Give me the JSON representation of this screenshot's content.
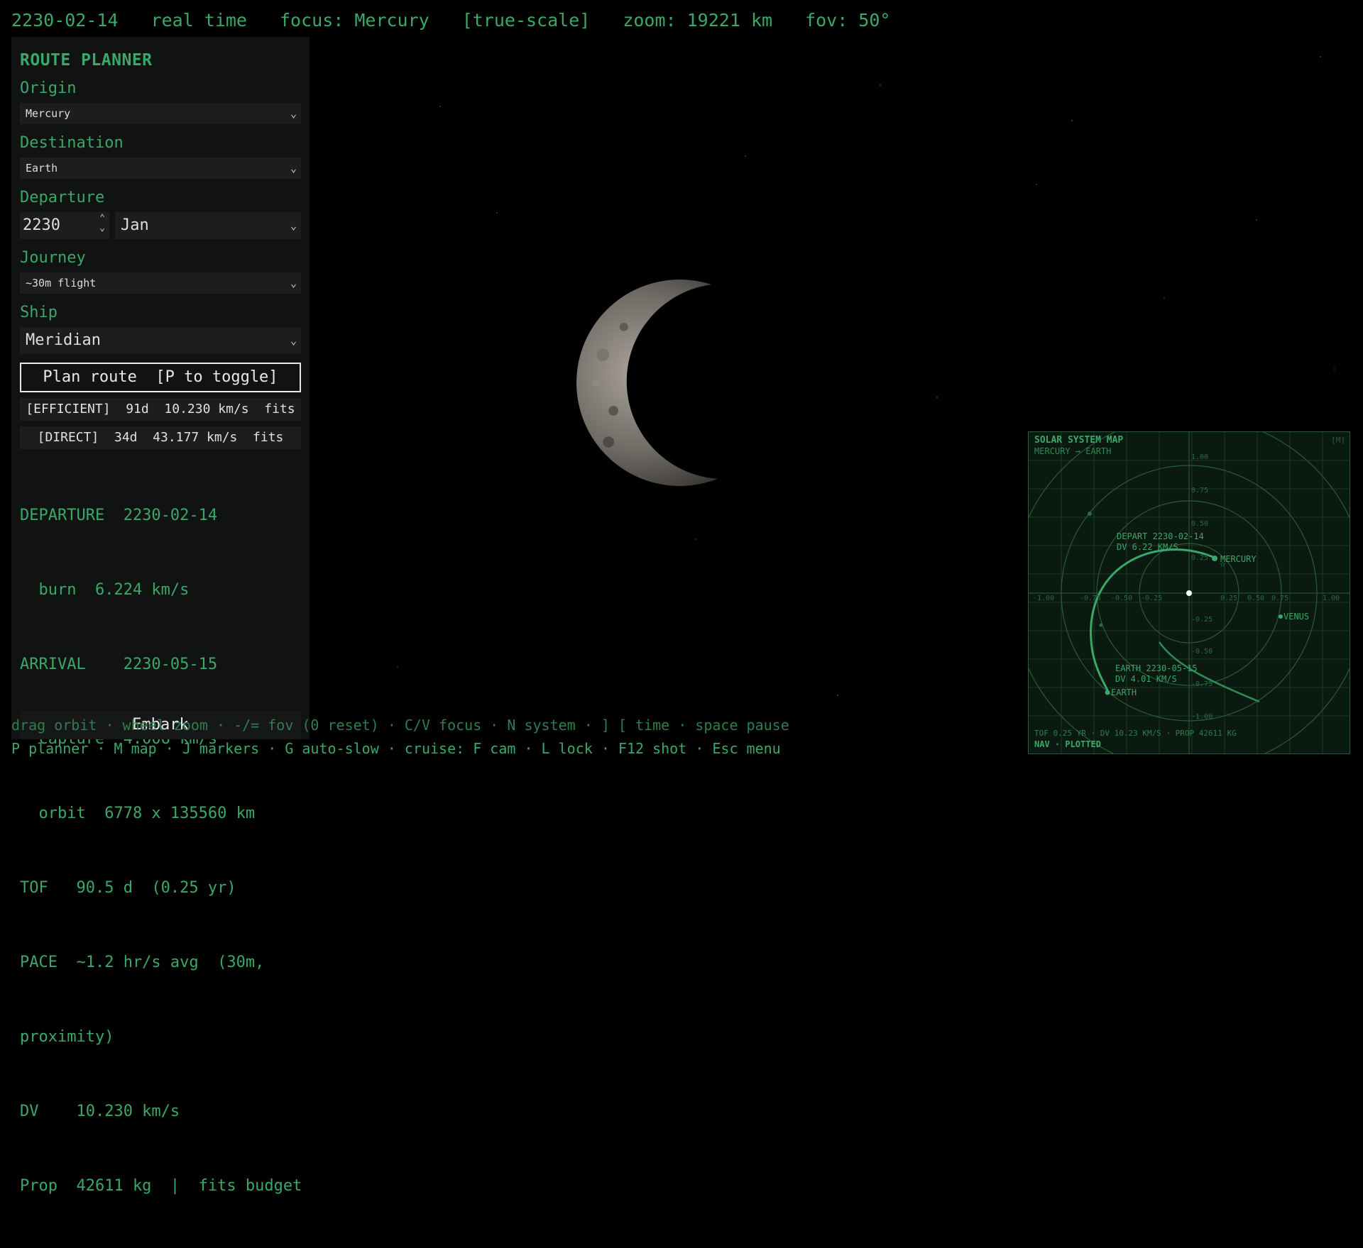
{
  "hud": {
    "date": "2230-02-14",
    "time_mode": "real time",
    "focus": "focus: Mercury",
    "scale_mode": "[true-scale]",
    "zoom": "zoom: 19221 km",
    "fov": "fov: 50°"
  },
  "planner": {
    "title": "ROUTE PLANNER",
    "origin_label": "Origin",
    "origin_value": "Mercury",
    "destination_label": "Destination",
    "destination_value": "Earth",
    "departure_label": "Departure",
    "departure_year": "2230",
    "departure_month": "Jan",
    "journey_label": "Journey",
    "journey_value": "~30m flight",
    "ship_label": "Ship",
    "ship_value": "Meridian",
    "plan_button": "Plan route  [P to toggle]",
    "options": [
      "[EFFICIENT]  91d  10.230 km/s  fits",
      "[DIRECT]  34d  43.177 km/s  fits"
    ],
    "details": [
      "DEPARTURE  2230-02-14",
      "  burn  6.224 km/s",
      "ARRIVAL    2230-05-15",
      "  capture  4.006 km/s",
      "  orbit  6778 x 135560 km",
      "TOF   90.5 d  (0.25 yr)",
      "PACE  ~1.2 hr/s avg  (30m,",
      "proximity)",
      "DV    10.230 km/s",
      "Prop  42611 kg  |  fits budget"
    ],
    "embark_button": "Embark"
  },
  "hints": {
    "line1": "drag orbit · wheel zoom · -/= fov (0 reset) · C/V focus · N system · ] [ time · space pause",
    "line2": "P planner · M map · J markers · G auto-slow · cruise: F cam · L lock · F12 shot · Esc menu"
  },
  "map": {
    "title": "SOLAR SYSTEM MAP",
    "subtitle": "MERCURY → EARTH",
    "key": "[M]",
    "depart_label": "DEPART 2230-02-14",
    "depart_dv": "DV 6.22 KM/S",
    "mercury_label": "MERCURY",
    "venus_label": "VENUS",
    "earth_label": "EARTH",
    "arrive_label": "EARTH 2230-05-15",
    "arrive_dv": "DV 4.01 KM/S",
    "footer": "TOF 0.25 YR · DV 10.23 KM/S · PROP 42611 KG",
    "status": "NAV · PLOTTED",
    "ticks_x": [
      "-1.00",
      "-0.75",
      "-0.50",
      "-0.25",
      "0.25",
      "0.50",
      "0.75",
      "1.00"
    ],
    "ticks_y": [
      "1.00",
      "0.75",
      "0.50",
      "0.25",
      "-0.25",
      "-0.50",
      "-0.75",
      "-1.00"
    ]
  },
  "colors": {
    "accent": "#3aa868",
    "panel_bg": "#111212",
    "map_bg": "#0a1a10"
  }
}
